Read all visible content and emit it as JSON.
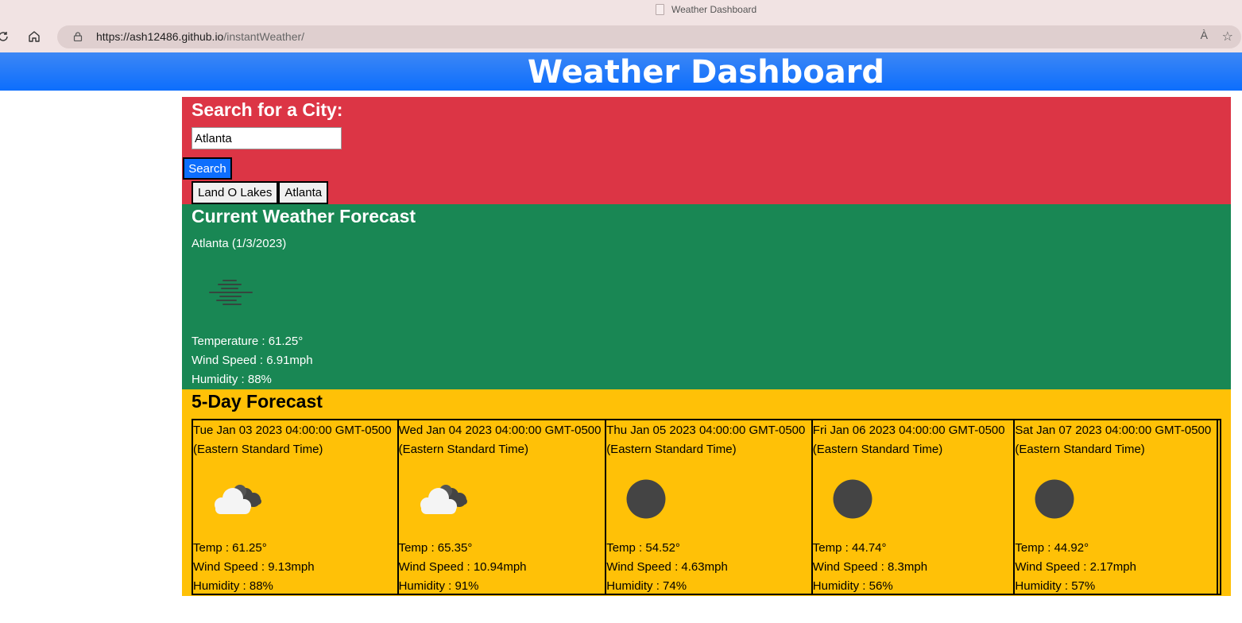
{
  "browser": {
    "tab_title": "Weather Dashboard",
    "url_host": "https://ash12486.github.io",
    "url_path": "/instantWeather/",
    "read_aloud_label": "À"
  },
  "header": {
    "title": "Weather Dashboard"
  },
  "search": {
    "heading": "Search for a City:",
    "input_value": "Atlanta",
    "button_label": "Search",
    "history": [
      "Land O Lakes",
      "Atlanta"
    ]
  },
  "current": {
    "heading": "Current Weather Forecast",
    "city_date": "Atlanta (1/3/2023)",
    "icon": "mist-icon",
    "temperature": "Temperature : 61.25°",
    "wind": "Wind Speed : 6.91mph",
    "humidity": "Humidity : 88%"
  },
  "forecast": {
    "heading": "5-Day Forecast",
    "days": [
      {
        "date": "Tue Jan 03 2023 04:00:00 GMT-0500 (Eastern Standard Time)",
        "icon": "partly-cloudy-icon",
        "temp": "Temp : 61.25°",
        "wind": "Wind Speed : 9.13mph",
        "humidity": "Humidity : 88%"
      },
      {
        "date": "Wed Jan 04 2023 04:00:00 GMT-0500 (Eastern Standard Time)",
        "icon": "partly-cloudy-icon",
        "temp": "Temp : 65.35°",
        "wind": "Wind Speed : 10.94mph",
        "humidity": "Humidity : 91%"
      },
      {
        "date": "Thu Jan 05 2023 04:00:00 GMT-0500 (Eastern Standard Time)",
        "icon": "clear-night-icon",
        "temp": "Temp : 54.52°",
        "wind": "Wind Speed : 4.63mph",
        "humidity": "Humidity : 74%"
      },
      {
        "date": "Fri Jan 06 2023 04:00:00 GMT-0500 (Eastern Standard Time)",
        "icon": "clear-night-icon",
        "temp": "Temp : 44.74°",
        "wind": "Wind Speed : 8.3mph",
        "humidity": "Humidity : 56%"
      },
      {
        "date": "Sat Jan 07 2023 04:00:00 GMT-0500 (Eastern Standard Time)",
        "icon": "clear-night-icon",
        "temp": "Temp : 44.92°",
        "wind": "Wind Speed : 2.17mph",
        "humidity": "Humidity : 57%"
      }
    ]
  },
  "colors": {
    "header_blue": "#0d6efd",
    "search_red": "#dc3545",
    "current_green": "#198754",
    "forecast_yellow": "#ffc107"
  }
}
